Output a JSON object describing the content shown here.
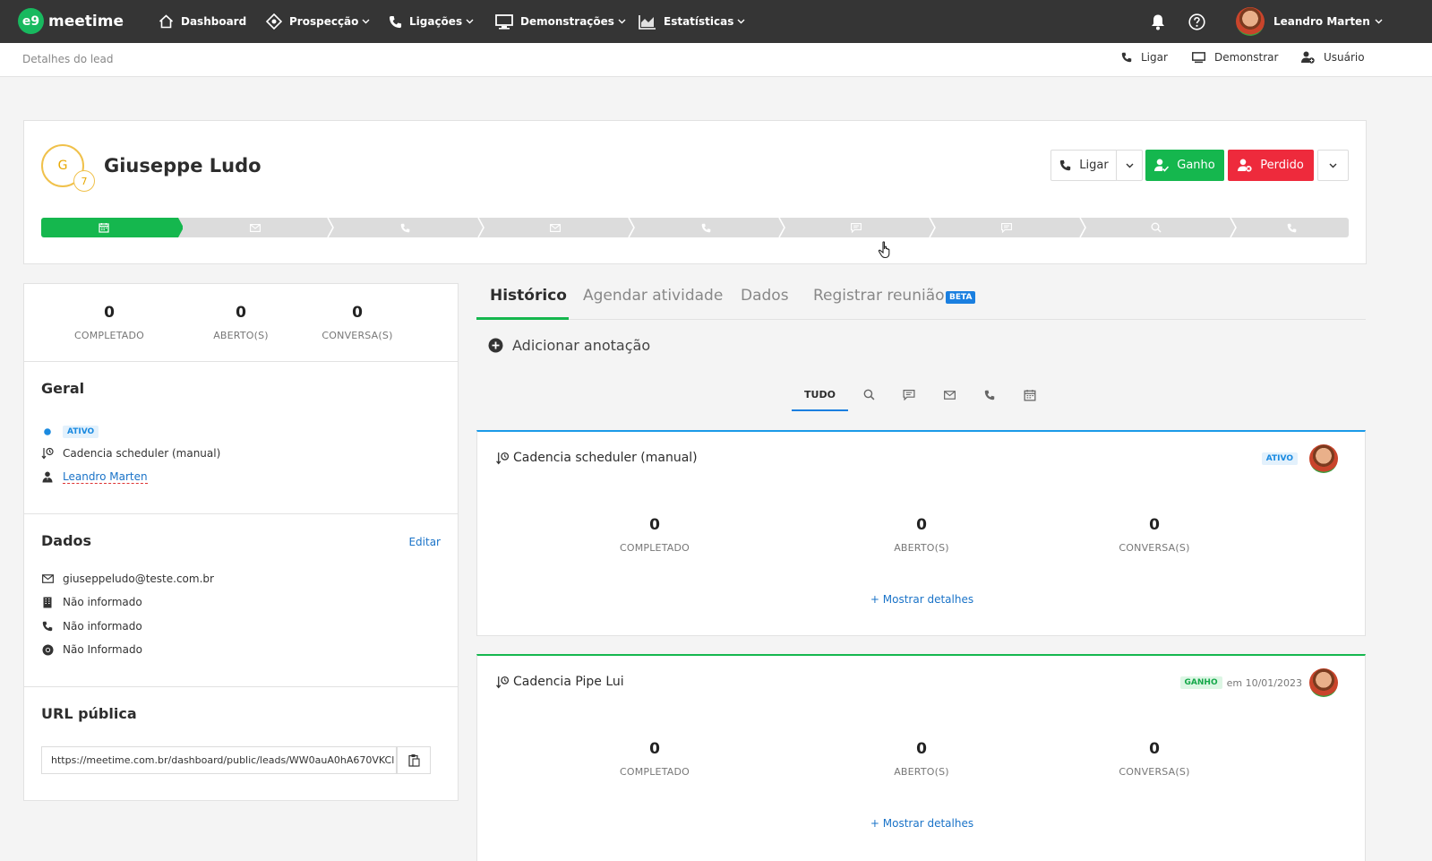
{
  "brand": {
    "name": "meetime",
    "mark": "e9"
  },
  "nav": {
    "dashboard": "Dashboard",
    "prospeccao": "Prospecção",
    "ligacoes": "Ligações",
    "demonstracoes": "Demonstrações",
    "estatisticas": "Estatísticas",
    "user_name": "Leandro Marten"
  },
  "subbar": {
    "breadcrumb": "Detalhes do lead",
    "ligar": "Ligar",
    "demonstrar": "Demonstrar",
    "usuario": "Usuário"
  },
  "lead": {
    "initial": "G",
    "badge_count": "7",
    "name": "Giuseppe Ludo",
    "btn_ligar": "Ligar",
    "btn_ganho": "Ganho",
    "btn_perdido": "Perdido",
    "steps": [
      "calendar-icon",
      "mail-icon",
      "phone-icon",
      "mail-icon",
      "phone-icon",
      "chat-icon",
      "chat-icon",
      "search-icon",
      "phone-icon"
    ],
    "steps_completed": 1
  },
  "summary": {
    "completado": "0",
    "completado_label": "COMPLETADO",
    "abertos": "0",
    "abertos_label": "ABERTO(S)",
    "conversas": "0",
    "conversas_label": "CONVERSA(S)"
  },
  "geral": {
    "title": "Geral",
    "status": "ATIVO",
    "cadence": "Cadencia scheduler (manual)",
    "owner": "Leandro Marten"
  },
  "dados": {
    "title": "Dados",
    "edit": "Editar",
    "email": "giuseppeludo@teste.com.br",
    "company": "Não informado",
    "phone": "Não informado",
    "website": "Não Informado"
  },
  "url_publica": {
    "title": "URL pública",
    "value": "https://meetime.com.br/dashboard/public/leads/WW0auA0hA670VKCl"
  },
  "tabs": {
    "historico": "Histórico",
    "agendar": "Agendar atividade",
    "dados": "Dados",
    "reuniao": "Registrar reunião",
    "beta": "BETA"
  },
  "add_note": "Adicionar anotação",
  "filters": {
    "all": "TUDO"
  },
  "history": [
    {
      "title": "Cadencia scheduler (manual)",
      "status": "ATIVO",
      "when": "",
      "accent": "#1a9ae8",
      "completado": "0",
      "abertos": "0",
      "conversas": "0",
      "completado_label": "COMPLETADO",
      "abertos_label": "ABERTO(S)",
      "conversas_label": "CONVERSA(S)",
      "details": "+ Mostrar detalhes"
    },
    {
      "title": "Cadencia Pipe Lui",
      "status": "GANHO",
      "when": "em 10/01/2023",
      "accent": "#15b74e",
      "completado": "0",
      "abertos": "0",
      "conversas": "0",
      "completado_label": "COMPLETADO",
      "abertos_label": "ABERTO(S)",
      "conversas_label": "CONVERSA(S)",
      "details": "+ Mostrar detalhes"
    }
  ],
  "colors": {
    "green": "#15b74e",
    "red": "#ee2a3c",
    "blue": "#1a7fe0",
    "nav_bg": "#353535"
  }
}
